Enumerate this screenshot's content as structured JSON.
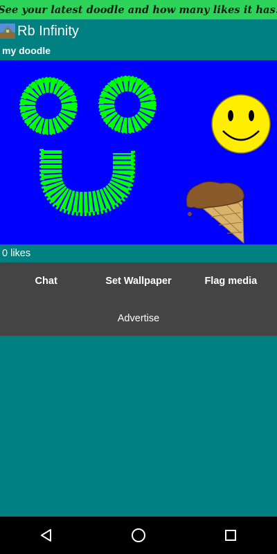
{
  "banner": {
    "text": "See your latest doodle and how many likes it has."
  },
  "app": {
    "title": "Rb Infinity"
  },
  "doodle": {
    "title": "my doodle",
    "canvas_color": "#0000ff"
  },
  "likes": {
    "text": "0 likes"
  },
  "actions": {
    "chat": "Chat",
    "set_wallpaper": "Set Wallpaper",
    "flag_media": "Flag media",
    "advertise": "Advertise"
  },
  "colors": {
    "background": "#008080",
    "banner": "#2ed35a",
    "panel": "#444444",
    "doodle_green": "#00ff00"
  },
  "icons": [
    "app-logo-icon",
    "smiley-face-icon",
    "ice-cream-cone-icon",
    "back-icon",
    "home-icon",
    "recents-icon"
  ]
}
